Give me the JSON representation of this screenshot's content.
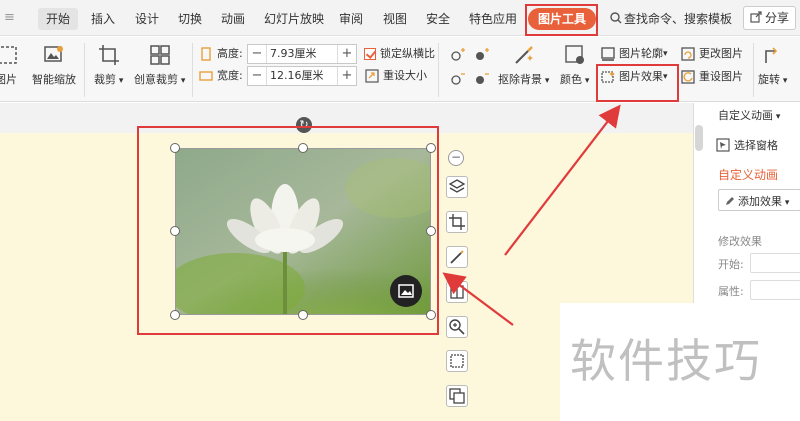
{
  "menu": {
    "tabs": [
      "开始",
      "插入",
      "设计",
      "切换",
      "动画",
      "幻灯片放映",
      "审阅",
      "视图",
      "安全",
      "特色应用"
    ],
    "picture_tools": "图片工具",
    "search": "查找命令、搜索模板",
    "share": "分享"
  },
  "ribbon": {
    "picture_label": "图片",
    "smart_zoom": "智能缩放",
    "crop": "裁剪",
    "creative_crop": "创意裁剪",
    "height_label": "高度:",
    "height_value": "7.93厘米",
    "width_label": "宽度:",
    "width_value": "12.16厘米",
    "lock_ratio": "锁定纵横比",
    "reset_size": "重设大小",
    "remove_bg": "抠除背景",
    "color": "颜色",
    "picture_outline": "图片轮廓",
    "picture_effects": "图片效果",
    "change_picture": "更改图片",
    "reset_picture": "重设图片",
    "rotate": "旋转",
    "minus": "−",
    "plus": "+"
  },
  "right_panel": {
    "title": "自定义动画",
    "select_pane": "选择窗格",
    "custom_anim": "自定义动画",
    "add_effect": "添加效果",
    "modify_effect": "修改效果",
    "start_label": "开始:",
    "property_label": "属性:"
  },
  "watermark": "软件技巧",
  "colors": {
    "accent": "#e8613a",
    "highlight_box": "#e03b3b",
    "slide_bg": "#fdf7dc"
  }
}
